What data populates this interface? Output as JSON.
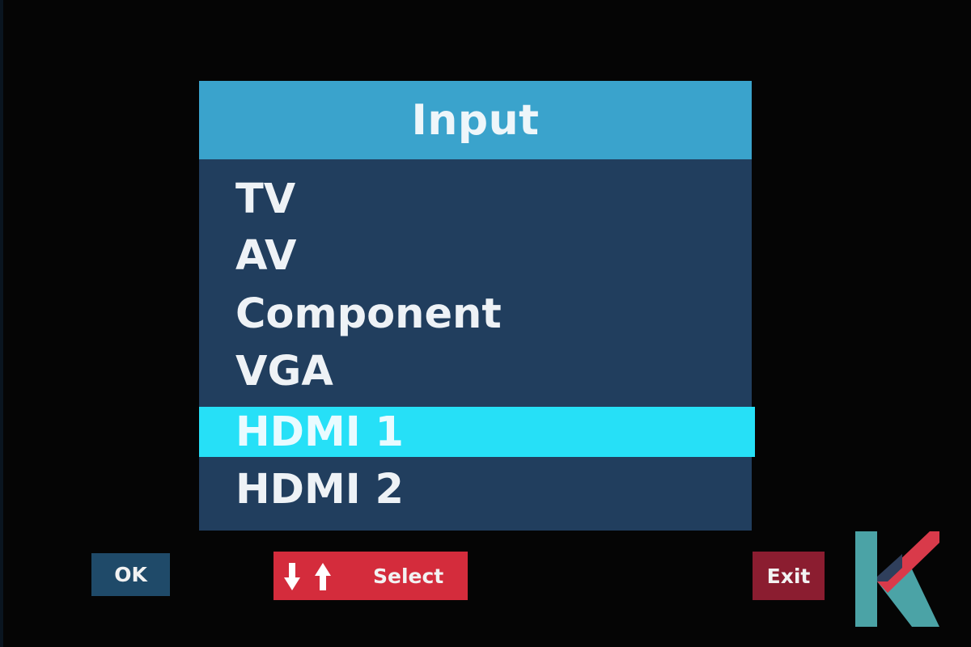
{
  "menu": {
    "title": "Input",
    "items": [
      {
        "label": "TV",
        "selected": false
      },
      {
        "label": "AV",
        "selected": false
      },
      {
        "label": "Component",
        "selected": false
      },
      {
        "label": "VGA",
        "selected": false
      },
      {
        "label": "HDMI 1",
        "selected": true
      },
      {
        "label": "HDMI 2",
        "selected": false
      }
    ]
  },
  "footer": {
    "ok_label": "OK",
    "select_label": "Select",
    "select_icon": "down-up-arrows-icon",
    "exit_label": "Exit"
  },
  "logo": {
    "icon": "k-logo",
    "colors": [
      "#4ba3a6",
      "#d93a4a"
    ]
  },
  "colors": {
    "background": "#050505",
    "panel": "#213e5e",
    "header": "#3aa3cc",
    "highlight": "#26e0f7",
    "ok_button": "#1f4a69",
    "select_button": "#d42c3c",
    "exit_button": "#8b1d30"
  }
}
